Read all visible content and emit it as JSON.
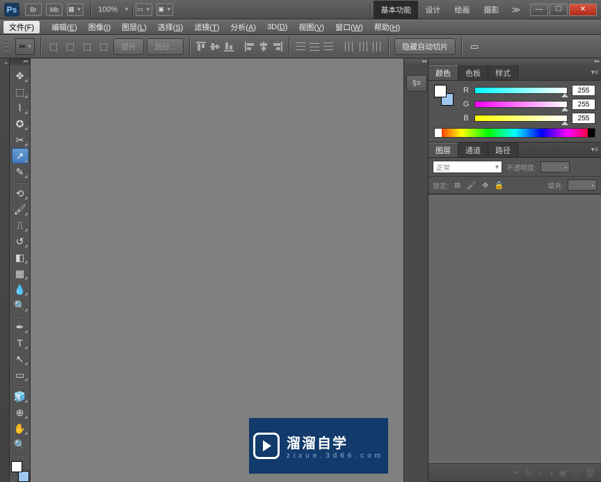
{
  "app": {
    "logo": "Ps",
    "badges": [
      "Br",
      "Mb"
    ],
    "zoom": "100%"
  },
  "workspace_tabs": [
    {
      "label": "基本功能",
      "active": true
    },
    {
      "label": "设计",
      "active": false
    },
    {
      "label": "绘画",
      "active": false
    },
    {
      "label": "摄影",
      "active": false
    }
  ],
  "menu": {
    "file": "文件(F)",
    "items": [
      {
        "label": "编辑",
        "key": "E"
      },
      {
        "label": "图像",
        "key": "I"
      },
      {
        "label": "图层",
        "key": "L"
      },
      {
        "label": "选择",
        "key": "S"
      },
      {
        "label": "滤镜",
        "key": "T"
      },
      {
        "label": "分析",
        "key": "A"
      },
      {
        "label": "3D",
        "key": "D"
      },
      {
        "label": "视图",
        "key": "V"
      },
      {
        "label": "窗口",
        "key": "W"
      },
      {
        "label": "帮助",
        "key": "H"
      }
    ]
  },
  "options": {
    "promote": "提升",
    "divide": "划分...",
    "hide_auto_slice": "隐藏自动切片"
  },
  "panels": {
    "color": {
      "tabs": [
        "颜色",
        "色板",
        "样式"
      ],
      "channels": [
        {
          "label": "R",
          "value": "255"
        },
        {
          "label": "G",
          "value": "255"
        },
        {
          "label": "B",
          "value": "255"
        }
      ]
    },
    "layers": {
      "tabs": [
        "图层",
        "通道",
        "路径"
      ],
      "blend_mode": "正常",
      "opacity_label": "不透明度:",
      "lock_label": "锁定:",
      "fill_label": "填充:"
    }
  },
  "watermark": {
    "main": "溜溜自学",
    "sub": "zixue.3d66.com"
  }
}
